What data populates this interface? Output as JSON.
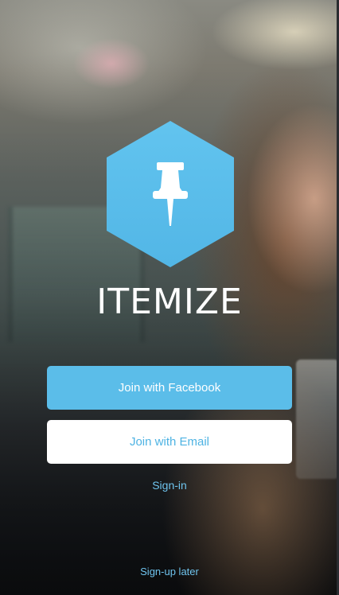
{
  "brand": {
    "app_name": "ITEMIZE",
    "logo_icon": "pushpin-icon",
    "accent_color": "#5bbde9"
  },
  "actions": {
    "facebook_label": "Join with Facebook",
    "email_label": "Join with Email",
    "signin_label": "Sign-in",
    "later_label": "Sign-up later"
  },
  "background": {
    "description_icon": "background-photo"
  }
}
